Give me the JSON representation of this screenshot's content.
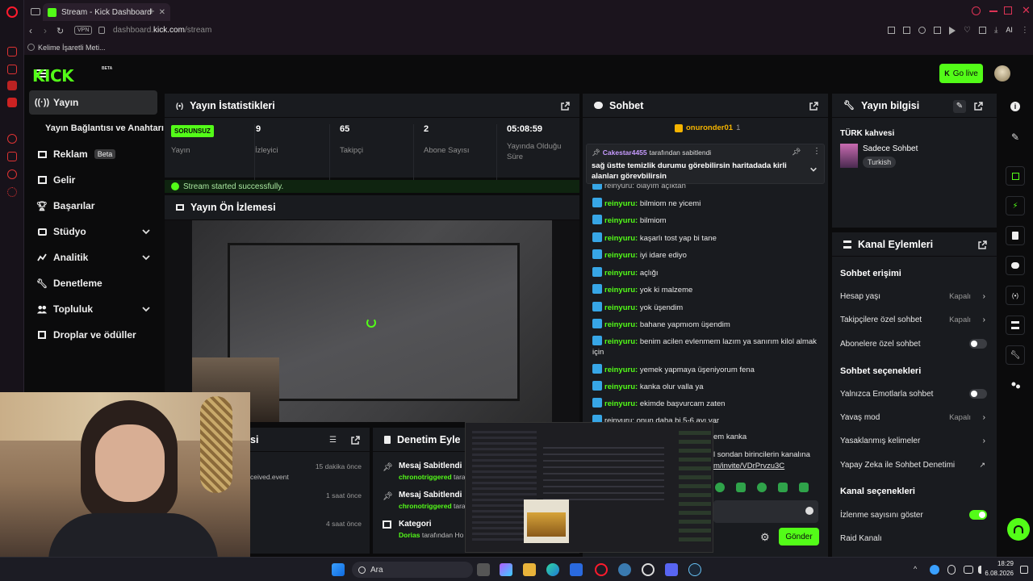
{
  "browser": {
    "tab_title": "Stream - Kick Dashboard",
    "url_prefix": "dashboard.",
    "url_domain": "kick.com",
    "url_path": "/stream",
    "vpn_label": "VPN",
    "bookmark": "Kelime İşaretli Meti...",
    "ai_label": "AI"
  },
  "header": {
    "logo": "KICK",
    "logo_badge": "BETA",
    "go_live": "Go live"
  },
  "sidebar": {
    "items": [
      {
        "label": "Yayın",
        "icon": "broadcast-icon"
      },
      {
        "label": "Yayın Bağlantısı ve Anahtarı",
        "icon": ""
      },
      {
        "label": "Reklam",
        "icon": "monitor-icon",
        "badge": "Beta"
      },
      {
        "label": "Gelir",
        "icon": "chart-icon"
      },
      {
        "label": "Başarılar",
        "icon": "trophy-icon"
      },
      {
        "label": "Stüdyo",
        "icon": "studio-icon"
      },
      {
        "label": "Analitik",
        "icon": "analytics-icon"
      },
      {
        "label": "Denetleme",
        "icon": "wrench-icon"
      },
      {
        "label": "Topluluk",
        "icon": "community-icon"
      },
      {
        "label": "Droplar ve ödüller",
        "icon": "gift-icon"
      }
    ]
  },
  "stats": {
    "title": "Yayın İstatistikleri",
    "status_badge": "SORUNSUZ",
    "status_label": "Yayın",
    "viewers": "9",
    "viewers_label": "İzleyici",
    "followers": "65",
    "followers_label": "Takipçi",
    "subs": "2",
    "subs_label": "Abone Sayısı",
    "uptime": "05:08:59",
    "uptime_label": "Yayında Olduğu Süre",
    "success_msg": "Stream started successfully."
  },
  "preview": {
    "title": "Yayın Ön İzlemesi"
  },
  "activity": {
    "title_fragment": "si",
    "items": [
      {
        "text": "ceived.event",
        "time": "15 dakika önce"
      },
      {
        "text": "",
        "time": "1 saat önce"
      },
      {
        "text": "",
        "time": "4 saat önce"
      }
    ]
  },
  "moderation": {
    "title": "Denetim Eyle",
    "items": [
      {
        "title": "Mesaj Sabitlendi",
        "user": "chronotriggered",
        "rest": " taraf"
      },
      {
        "title": "Mesaj Sabitlendi",
        "user": "chronotriggered",
        "rest": " taraf"
      },
      {
        "title": "Kategori",
        "user": "Dorias",
        "rest": " tarafından Ho"
      }
    ]
  },
  "chat": {
    "title": "Sohbet",
    "top_user": "onuronder01",
    "top_count": "1",
    "pinned_user": "Cakestar4455",
    "pinned_by": " tarafından sabitlendi",
    "pinned_text": "sağ üstte temizlik durumu görebilirsin haritadada kirli alanları görevbilirsin",
    "messages": [
      {
        "user": "reinyuru",
        "text": "bilmiom ne yicemi"
      },
      {
        "user": "reinyuru",
        "text": "bilmiom"
      },
      {
        "user": "reinyuru",
        "text": "kaşarlı tost yap bi tane"
      },
      {
        "user": "reinyuru",
        "text": "iyi idare ediyo"
      },
      {
        "user": "reinyuru",
        "text": "açlığı"
      },
      {
        "user": "reinyuru",
        "text": "yok ki malzeme"
      },
      {
        "user": "reinyuru",
        "text": "yok üşendim"
      },
      {
        "user": "reinyuru",
        "text": "bahane yapmıom üşendim"
      },
      {
        "user": "reinyuru",
        "text": "benim acilen evlenmem lazım ya sanırım kilol almak için"
      },
      {
        "user": "reinyuru",
        "text": "yemek yapmaya üşeniyorum fena"
      },
      {
        "user": "reinyuru",
        "text": "kanka olur valla ya"
      },
      {
        "user": "reinyuru",
        "text": "ekimde başvurcam zaten"
      }
    ],
    "partial_top": "reinyuru: olayım açıktan",
    "partial_bottom": "reinyuru: onun daha bi 5-6 ayı var",
    "frag1": "em kanka",
    "frag2": "l sondan birincilerin kanalına",
    "frag3": "m/invite/VDrPrvzu3C",
    "send": "Gönder"
  },
  "info": {
    "title": "Yayın bilgisi",
    "stream_title": "TÜRK kahvesi",
    "category": "Sadece Sohbet",
    "language": "Turkish"
  },
  "channel": {
    "title": "Kanal Eylemleri",
    "chat_access": "Sohbet erişimi",
    "account_age": "Hesap yaşı",
    "account_age_val": "Kapalı",
    "followers_only": "Takipçilere özel sohbet",
    "followers_only_val": "Kapalı",
    "subs_only": "Abonelere özel sohbet",
    "chat_options": "Sohbet seçenekleri",
    "emote_only": "Yalnızca Emotlarla sohbet",
    "slow_mode": "Yavaş mod",
    "slow_mode_val": "Kapalı",
    "banned_words": "Yasaklanmış kelimeler",
    "ai_mod": "Yapay Zeka ile Sohbet Denetimi",
    "channel_options": "Kanal seçenekleri",
    "show_viewers": "İzlenme sayısını göster",
    "raid": "Raid Kanalı"
  },
  "taskbar": {
    "search": "Ara",
    "time": "18:29",
    "date": "6.08.2026"
  },
  "colors": {
    "accent": "#53fc18",
    "panel": "#191b1f",
    "bg": "#0b0b0c"
  }
}
